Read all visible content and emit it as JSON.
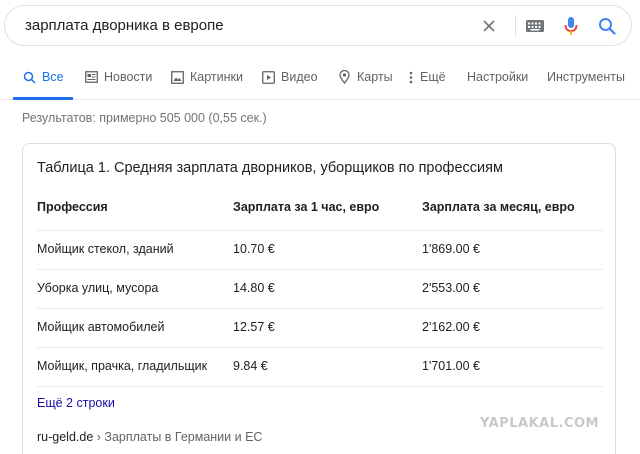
{
  "search": {
    "query": "зарплата дворника в европе"
  },
  "tabs": [
    {
      "label": "Все",
      "icon": "search-icon"
    },
    {
      "label": "Новости",
      "icon": "news-icon"
    },
    {
      "label": "Картинки",
      "icon": "image-icon"
    },
    {
      "label": "Видео",
      "icon": "video-icon"
    },
    {
      "label": "Карты",
      "icon": "map-pin-icon"
    },
    {
      "label": "Ещё",
      "icon": "more-vert-icon"
    },
    {
      "label": "Настройки"
    },
    {
      "label": "Инструменты"
    }
  ],
  "results_count": "Результатов: примерно 505 000 (0,55 сек.)",
  "snippet": {
    "title": "Таблица 1. Средняя зарплата дворников, уборщиков по профессиям",
    "headers": [
      "Профессия",
      "Зарплата за 1 час, евро",
      "Зарплата за месяц, евро"
    ],
    "rows": [
      [
        "Мойщик стекол, зданий",
        "10.70 €",
        "1'869.00 €"
      ],
      [
        "Уборка улиц, мусора",
        "14.80 €",
        "2'553.00 €"
      ],
      [
        "Мойщик автомобилей",
        "12.57 €",
        "2'162.00 €"
      ],
      [
        "Мойщик, прачка, гладильщик",
        "9.84 €",
        "1'701.00 €"
      ]
    ],
    "more_link": "Ещё 2 строки",
    "source_domain": "ru-geld.de",
    "source_path": " › Зарплаты в Германии и ЕС"
  },
  "watermark": "YAPLAKAL.COM",
  "colors": {
    "accent": "#1a73e8",
    "link": "#1a0dab",
    "mic_blue": "#4285f4",
    "mic_red": "#ea4335"
  }
}
